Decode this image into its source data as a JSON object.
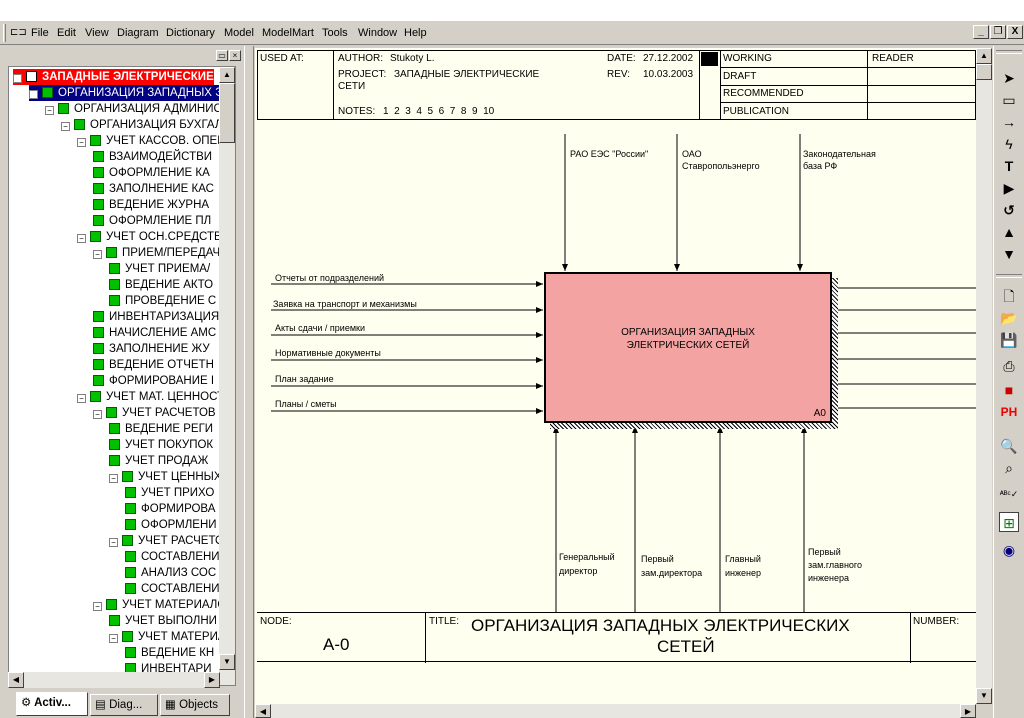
{
  "menu": [
    "File",
    "Edit",
    "View",
    "Diagram",
    "Dictionary",
    "Model",
    "ModelMart",
    "Tools",
    "Window",
    "Help"
  ],
  "window_buttons": [
    "_",
    "❐",
    "X"
  ],
  "tree": [
    {
      "label": "ЗАПАДНЫЕ ЭЛЕКТРИЧЕСКИЕ",
      "level": 0,
      "kind": "root"
    },
    {
      "label": "ОРГАНИЗАЦИЯ ЗАПАДНЫХ Э",
      "level": 1,
      "kind": "sel"
    },
    {
      "label": "ОРГАНИЗАЦИЯ АДМИНИСТ",
      "level": 2
    },
    {
      "label": "ОРГАНИЗАЦИЯ БУХГАЛТ",
      "level": 3
    },
    {
      "label": "УЧЕТ КАССОВ. ОПЕРА",
      "level": 4
    },
    {
      "label": "ВЗАИМОДЕЙСТВИ",
      "level": 5
    },
    {
      "label": "ОФОРМЛЕНИЕ КА",
      "level": 5
    },
    {
      "label": "ЗАПОЛНЕНИЕ КАС",
      "level": 5
    },
    {
      "label": "ВЕДЕНИЕ ЖУРНА",
      "level": 5
    },
    {
      "label": "ОФОРМЛЕНИЕ ПЛ",
      "level": 5
    },
    {
      "label": "УЧЕТ ОСН.СРЕДСТВ",
      "level": 4
    },
    {
      "label": "ПРИЕМ/ПЕРЕДАЧ",
      "level": 5
    },
    {
      "label": "УЧЕТ ПРИЕМА/",
      "level": 6
    },
    {
      "label": "ВЕДЕНИЕ АКТО",
      "level": 6
    },
    {
      "label": "ПРОВЕДЕНИЕ С",
      "level": 6
    },
    {
      "label": "ИНВЕНТАРИЗАЦИЯ",
      "level": 5
    },
    {
      "label": "НАЧИСЛЕНИЕ АМС",
      "level": 5
    },
    {
      "label": "ЗАПОЛНЕНИЕ ЖУ",
      "level": 5
    },
    {
      "label": "ВЕДЕНИЕ ОТЧЕТН",
      "level": 5
    },
    {
      "label": "ФОРМИРОВАНИЕ I",
      "level": 5
    },
    {
      "label": "УЧЕТ МАТ. ЦЕННОСТ",
      "level": 4
    },
    {
      "label": "УЧЕТ РАСЧЕТОВ С",
      "level": 5
    },
    {
      "label": "ВЕДЕНИЕ РЕГИ",
      "level": 6
    },
    {
      "label": "УЧЕТ ПОКУПОК",
      "level": 6
    },
    {
      "label": "УЧЕТ ПРОДАЖ",
      "level": 6
    },
    {
      "label": "УЧЕТ ЦЕННЫХ",
      "level": 6
    },
    {
      "label": "УЧЕТ ПРИХО",
      "level": 7
    },
    {
      "label": "ФОРМИРОВА",
      "level": 7
    },
    {
      "label": "ОФОРМЛЕНИ",
      "level": 7
    },
    {
      "label": "УЧЕТ РАСЧЕТО",
      "level": 6
    },
    {
      "label": "СОСТАВЛЕНИ",
      "level": 7
    },
    {
      "label": "АНАЛИЗ СОС",
      "level": 7
    },
    {
      "label": "СОСТАВЛЕНИ",
      "level": 7
    },
    {
      "label": "УЧЕТ МАТЕРИАЛО",
      "level": 5
    },
    {
      "label": "УЧЕТ ВЫПОЛНИ",
      "level": 6
    },
    {
      "label": "УЧЕТ МАТЕРИА",
      "level": 6
    },
    {
      "label": "ВЕДЕНИЕ КН",
      "level": 7
    },
    {
      "label": "ИНВЕНТАРИ",
      "level": 7
    }
  ],
  "tabs": [
    "Activ...",
    "Diag...",
    "Objects"
  ],
  "header": {
    "used_at": "USED AT:",
    "author_label": "AUTHOR:",
    "author": "Stukoty L.",
    "project_label": "PROJECT:",
    "project": "ЗАПАДНЫЕ ЭЛЕКТРИЧЕСКИЕ",
    "project_cont": "СЕТИ",
    "notes_label": "NOTES:",
    "notes": "1  2  3  4  5  6  7  8  9  10",
    "date_label": "DATE:",
    "date": "27.12.2002",
    "rev_label": "REV:",
    "rev": "10.03.2003",
    "statuses": [
      "WORKING",
      "DRAFT",
      "RECOMMENDED",
      "PUBLICATION"
    ],
    "reader": "READER"
  },
  "controls": [
    {
      "label": "РАО ЕЭС \"России\""
    },
    {
      "label": "ОАО\nСтавропольэнерго"
    },
    {
      "label": "Законодательная\nбаза РФ"
    }
  ],
  "inputs": [
    {
      "label": "Отчеты от подразделений"
    },
    {
      "label": "Заявка на транспорт и механизмы"
    },
    {
      "label": "Акты сдачи / приемки"
    },
    {
      "label": "Нормативные документы"
    },
    {
      "label": "План задание"
    },
    {
      "label": "Планы / сметы"
    }
  ],
  "mechanisms": [
    {
      "label": "Генеральный\nдиректор"
    },
    {
      "label": "Первый\nзам.директора"
    },
    {
      "label": "Главный\nинженер"
    },
    {
      "label": "Первый\nзам.главного\nинженера"
    }
  ],
  "function": {
    "title": "ОРГАНИЗАЦИЯ ЗАПАДНЫХ\nЭЛЕКТРИЧЕСКИХ СЕТЕЙ",
    "id": "A0"
  },
  "footer": {
    "node_label": "NODE:",
    "node": "A-0",
    "title_label": "TITLE:",
    "title_line1": "ОРГАНИЗАЦИЯ ЗАПАДНЫХ  ЭЛЕКТРИЧЕСКИХ",
    "title_line2": "СЕТЕЙ",
    "number_label": "NUMBER:"
  },
  "toolbar_icons": [
    "pointer-icon",
    "box-icon",
    "arrow-icon",
    "squiggle-icon",
    "text-icon",
    "play-icon",
    "rotate-icon",
    "up-icon",
    "down-icon",
    "new-icon",
    "open-icon",
    "save-icon",
    "print-icon",
    "colors-icon",
    "ph-icon",
    "zoom-in-icon",
    "zoom-out-icon",
    "spellcheck-icon",
    "tree-icon",
    "globe-icon"
  ],
  "colors": {
    "root_bg": "#ff0000",
    "sel_bg": "#000080",
    "box_fill": "#f4a3a3",
    "tree_node": "#00c000"
  }
}
